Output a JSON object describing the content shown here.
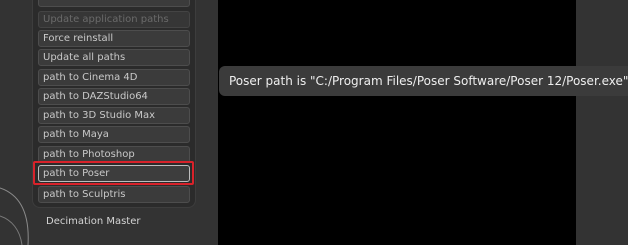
{
  "sidebar": {
    "buttons": [
      {
        "label": "Update application paths",
        "faded": true
      },
      {
        "label": "Force reinstall",
        "faded": false
      },
      {
        "label": "Update all paths",
        "faded": false
      },
      {
        "label": "path to Cinema 4D",
        "faded": false
      },
      {
        "label": "path to DAZStudio64",
        "faded": false
      },
      {
        "label": "path to 3D Studio Max",
        "faded": false
      },
      {
        "label": "path to Maya",
        "faded": false
      },
      {
        "label": "path to Photoshop",
        "faded": false
      },
      {
        "label": "path to Poser",
        "faded": false,
        "selected": true
      },
      {
        "label": "path to Sculptris",
        "faded": false
      }
    ],
    "footer_label": "Decimation Master"
  },
  "tooltip": {
    "text": "Poser path is \"C:/Program Files/Poser Software/Poser 12/Poser.exe\""
  },
  "colors": {
    "highlight": "#d8222a",
    "panel": "#2b2b2b",
    "button": "#3b3b3b",
    "main_area": "#000000"
  }
}
